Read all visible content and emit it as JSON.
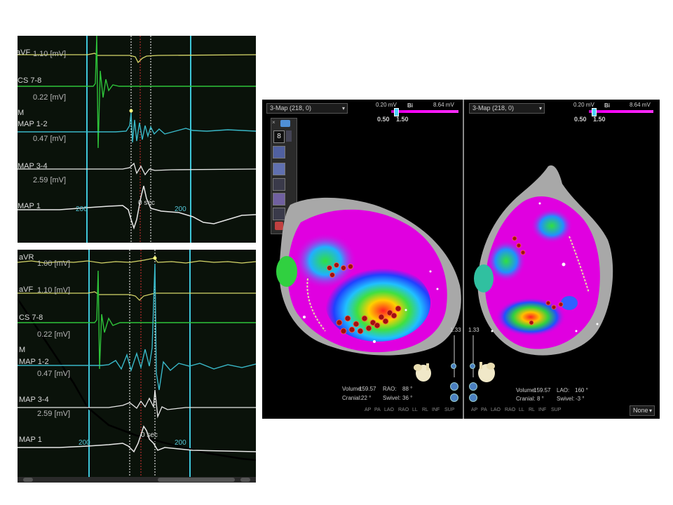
{
  "egm_top": {
    "channels": [
      {
        "name": "aVF",
        "scale": "1.10 [mV]"
      },
      {
        "name": "CS 7-8",
        "scale": "0.22 [mV]"
      },
      {
        "name": "MAP 1-2",
        "scale": "0.47 [mV]"
      },
      {
        "name": "MAP 3-4",
        "scale": "2.59 [mV]"
      },
      {
        "name": "MAP 1",
        "scale": ""
      }
    ],
    "side_marker": "M",
    "time_left": "200",
    "time_center": "0 sec",
    "time_right": "200"
  },
  "egm_bottom": {
    "channels": [
      {
        "name": "aVR",
        "scale": "1.00 [mV]"
      },
      {
        "name": "aVF",
        "scale": "1.10 [mV]"
      },
      {
        "name": "CS 7-8",
        "scale": "0.22 [mV]"
      },
      {
        "name": "MAP 1-2",
        "scale": "0.47 [mV]"
      },
      {
        "name": "MAP 3-4",
        "scale": "2.59 [mV]"
      },
      {
        "name": "MAP 1",
        "scale": ""
      }
    ],
    "side_marker": "M",
    "time_left": "200",
    "time_center": "0 sec",
    "time_right": "200"
  },
  "map_left": {
    "dropdown": "3-Map (218, 0)",
    "scale_min": "0.20 mV",
    "scale_mode": "Bi",
    "scale_max": "8.64 mV",
    "scale_lo": "0.50",
    "scale_hi": "1.50",
    "point_count": "8",
    "zoom": "1.33",
    "volume_label": "Volume:",
    "volume": "159.57",
    "proj1_label": "RAO:",
    "proj1": "88 °",
    "cranial_label": "Cranial:",
    "cranial": "22 °",
    "swivel_label": "Swivel:",
    "swivel": "36 °",
    "views": [
      "AP",
      "PA",
      "LAO",
      "RAO",
      "LL",
      "RL",
      "INF",
      "SUP"
    ]
  },
  "map_right": {
    "dropdown": "3-Map (218, 0)",
    "scale_min": "0.20 mV",
    "scale_mode": "Bi",
    "scale_max": "8.64 mV",
    "scale_lo": "0.50",
    "scale_hi": "1.50",
    "zoom": "1.33",
    "volume_label": "Volume:",
    "volume": "159.57",
    "proj1_label": "LAO:",
    "proj1": "160 °",
    "cranial_label": "Cranial:",
    "cranial": "8 °",
    "swivel_label": "Swivel:",
    "swivel": "-3 °",
    "views": [
      "AP",
      "PA",
      "LAO",
      "RAO",
      "LL",
      "RL",
      "INF",
      "SUP"
    ],
    "none_select": "None"
  },
  "colors": {
    "ecg_yellow": "#d8d86a",
    "cs_green": "#2ec43a",
    "map12_cyan": "#39b8c8",
    "white_trace": "#e8e8e8",
    "cursor_cyan": "#3ec6d8",
    "map_magenta": "#e000e0",
    "map_gray": "#a8a8a8"
  }
}
